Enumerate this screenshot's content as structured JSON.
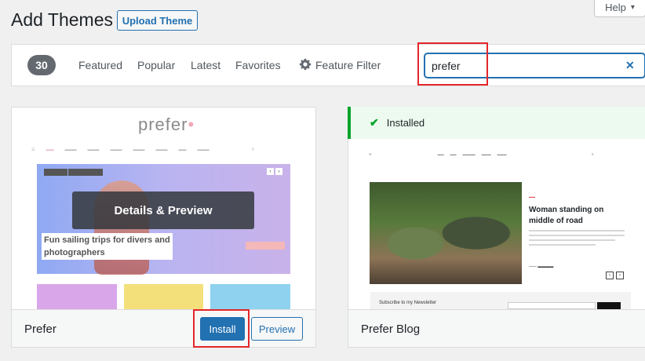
{
  "header": {
    "title": "Add Themes",
    "upload_label": "Upload Theme",
    "help_label": "Help"
  },
  "filter": {
    "count": "30",
    "links": [
      "Featured",
      "Popular",
      "Latest",
      "Favorites"
    ],
    "feature_filter_label": "Feature Filter",
    "search_value": "prefer"
  },
  "themes": [
    {
      "name": "Prefer",
      "logo": "prefer",
      "overlay_label": "Details & Preview",
      "hero_caption_line1": "Fun sailing trips for divers and",
      "hero_caption_line2": "photographers",
      "install_label": "Install",
      "preview_label": "Preview"
    },
    {
      "name": "Prefer Blog",
      "installed_label": "Installed",
      "post_title_line1": "Woman standing on",
      "post_title_line2": "middle of road",
      "newsletter_label": "Subscribe to my Newsletter"
    }
  ],
  "colors": {
    "accent": "#2271b1",
    "highlight": "#e3262b",
    "installed": "#00a32a"
  }
}
